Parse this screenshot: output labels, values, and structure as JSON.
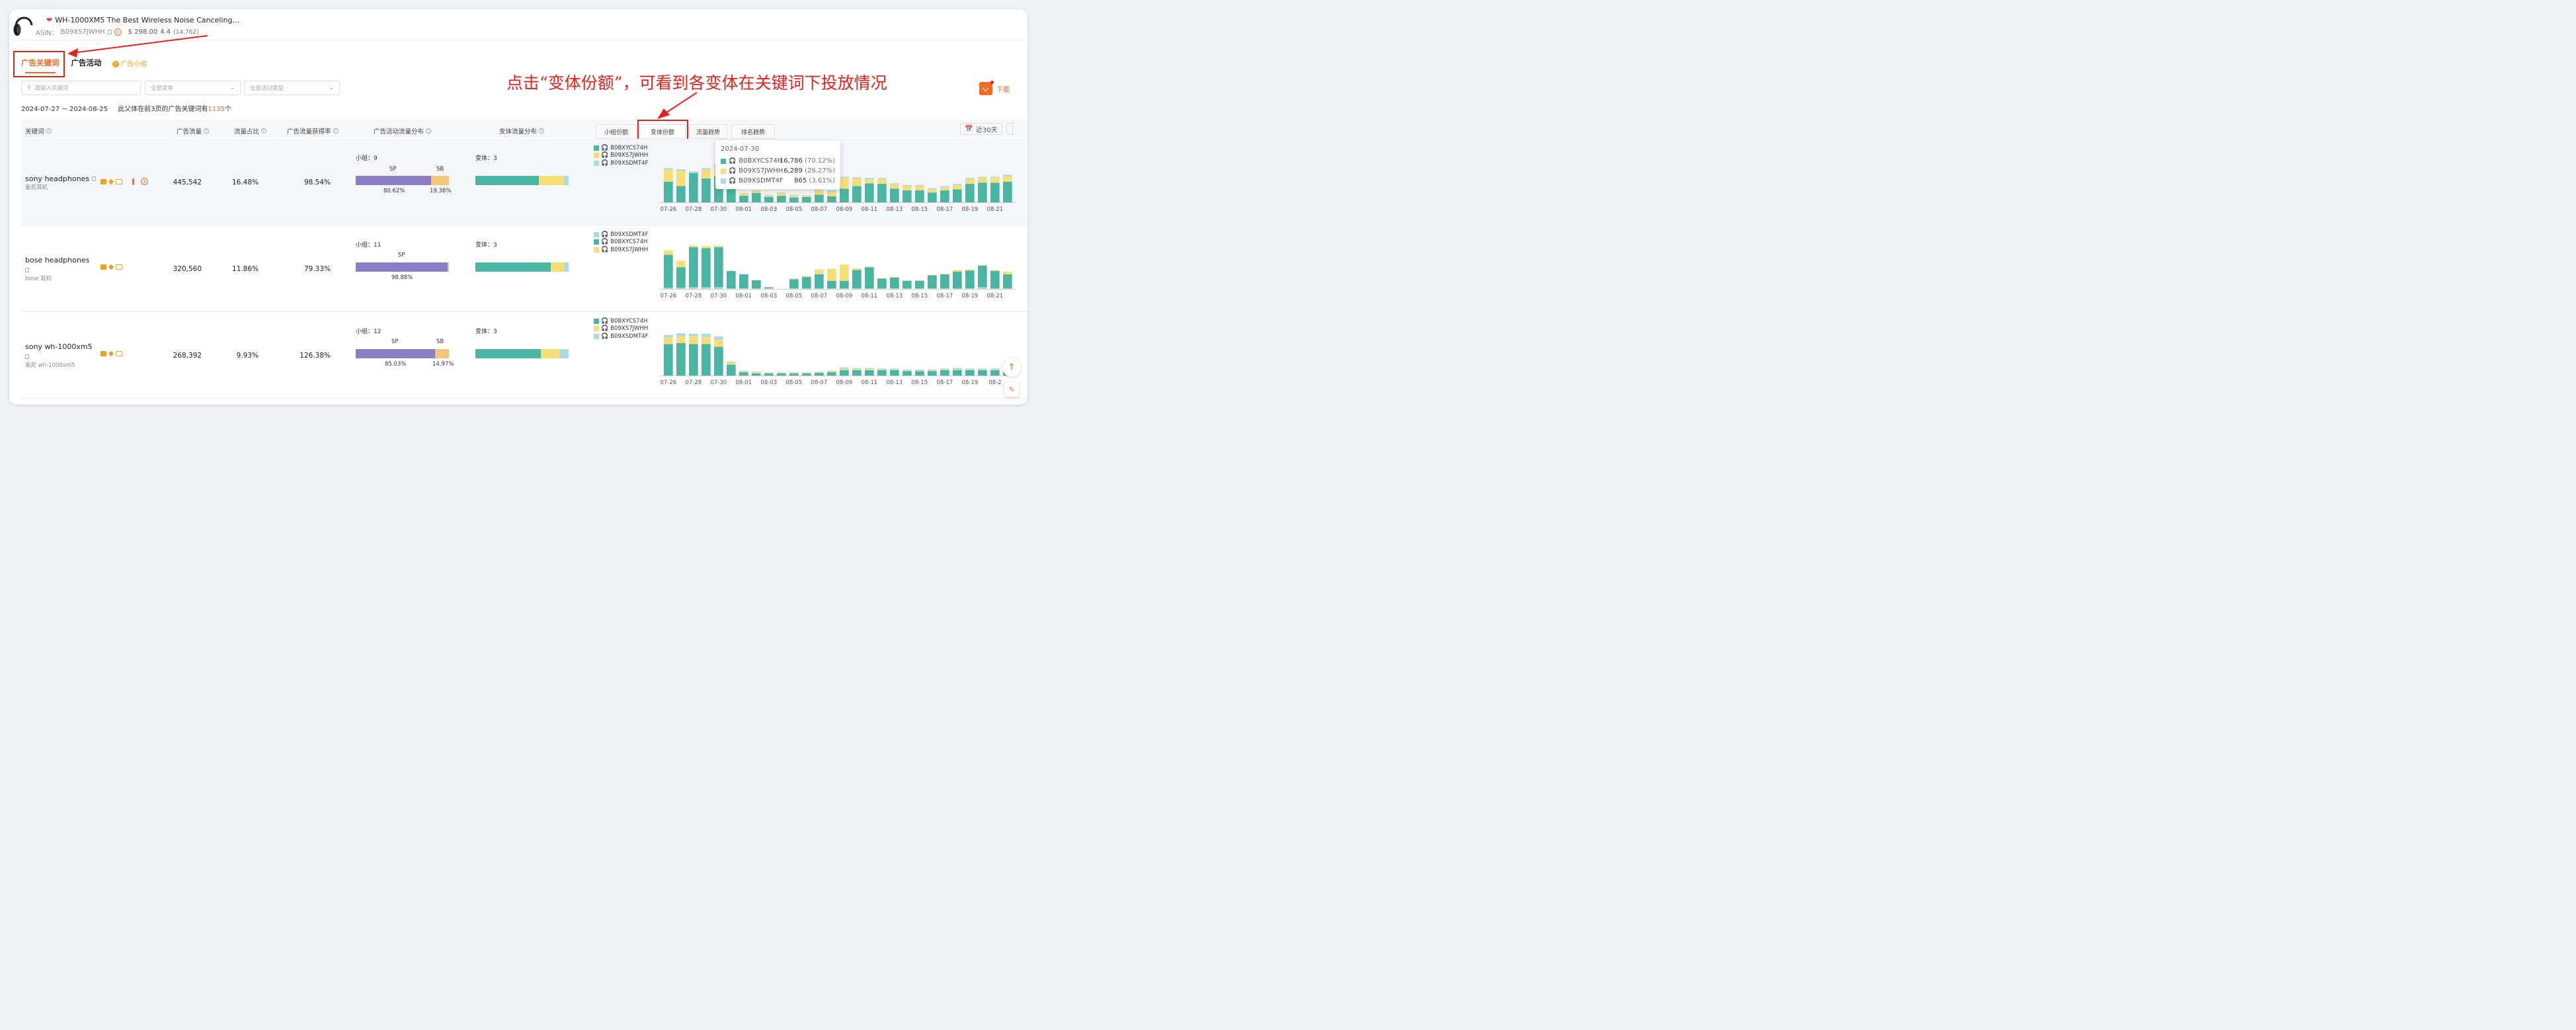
{
  "product": {
    "title": "WH-1000XM5 The Best Wireless Noise Canceling...",
    "asin_label": "ASIN：",
    "asin": "B09XS7JWHH",
    "price": "$ 298.00",
    "rating": "4.4",
    "reviews": "(14,762)",
    "badge": "3"
  },
  "tabs": {
    "keywords": "广告关键词",
    "campaigns": "广告活动",
    "groups": "广告小组"
  },
  "filters": {
    "search_placeholder": "请输入关键词",
    "variant_select": "全部变体",
    "campaign_type_select": "全部活动类型"
  },
  "summary": {
    "date_range": "2024-07-27 ~ 2024-08-25",
    "text_before": "此父体在前3页的广告关键词有",
    "count": "1135",
    "text_after": "个"
  },
  "annotation": "点击“变体份额”，可看到各变体在关键词下投放情况",
  "download_label": "下载",
  "columns": {
    "keyword": "关键词",
    "ad_traffic": "广告流量",
    "traffic_share": "流量占比",
    "capture_rate": "广告流量获得率",
    "campaign_dist": "广告活动流量分布",
    "variant_dist": "变体流量分布"
  },
  "subtabs": [
    "小组份额",
    "变体份额",
    "流量趋势",
    "排名趋势"
  ],
  "range_label": "近30天",
  "group_label": "小组：",
  "variant_label": "变体：",
  "colors": {
    "B0BXYCS74H": "#4ab5a2",
    "B09XS7JWHH": "#f7df76",
    "B09XSDMT4F": "#a9dbe8",
    "sp": "#8b7dc4",
    "sb": "#f5c67a",
    "accent": "#f26b21"
  },
  "x_ticks": [
    "07-26",
    "07-28",
    "07-30",
    "08-01",
    "08-03",
    "08-05",
    "08-07",
    "08-09",
    "08-11",
    "08-13",
    "08-15",
    "08-17",
    "08-19",
    "08-21"
  ],
  "x_ticks_row3": [
    "07-26",
    "07-28",
    "07-30",
    "08-01",
    "08-03",
    "08-05",
    "08-07",
    "08-09",
    "08-11",
    "08-13",
    "08-15",
    "08-17",
    "08-19",
    "08-2"
  ],
  "rows": [
    {
      "keyword": "sony headphones",
      "sub": "索尼耳机",
      "traffic": "445,542",
      "share": "16.48%",
      "rate": "98.54%",
      "groups": "9",
      "sp_label": "SP",
      "sb_label": "SB",
      "sp_pct": "80.62%",
      "sb_pct": "19.38%",
      "sp_value": 80.62,
      "variants": "3",
      "variant_split": [
        68,
        27,
        5
      ],
      "legend": [
        "B0BXYCS74H",
        "B09XS7JWHH",
        "B09XSDMT4F"
      ]
    },
    {
      "keyword": "bose headphones",
      "sub": "bose 耳机",
      "traffic": "320,560",
      "share": "11.86%",
      "rate": "79.33%",
      "groups": "11",
      "sp_label": "SP",
      "sp_pct": "98.88%",
      "sp_value": 98.88,
      "variants": "3",
      "variant_split": [
        81,
        14,
        5
      ],
      "legend": [
        "B09XSDMT4F",
        "B0BXYCS74H",
        "B09XS7JWHH"
      ]
    },
    {
      "keyword": "sony wh-1000xm5",
      "sub": "索尼 wh-1000xm5",
      "traffic": "268,392",
      "share": "9.93%",
      "rate": "126.38%",
      "groups": "12",
      "sp_label": "SP",
      "sb_label": "SB",
      "sp_pct": "85.03%",
      "sb_pct": "14.97%",
      "sp_value": 85.03,
      "variants": "3",
      "variant_split": [
        70,
        20,
        10
      ],
      "legend": [
        "B0BXYCS74H",
        "B09XS7JWHH",
        "B09XSDMT4F"
      ]
    }
  ],
  "tooltip": {
    "date": "2024-07-30",
    "items": [
      {
        "name": "B0BXYCS74H",
        "value": "16,786",
        "pct": "(70.12%)"
      },
      {
        "name": "B09XS7JWHH",
        "value": "6,289",
        "pct": "(26.27%)"
      },
      {
        "name": "B09XSDMT4F",
        "value": "865",
        "pct": "(3.61%)"
      }
    ]
  },
  "chart_data": [
    {
      "type": "bar",
      "stacked": true,
      "x": [
        "07-26",
        "07-27",
        "07-28",
        "07-29",
        "07-30",
        "07-31",
        "08-01",
        "08-02",
        "08-03",
        "08-04",
        "08-05",
        "08-06",
        "08-07",
        "08-08",
        "08-09",
        "08-10",
        "08-11",
        "08-12",
        "08-13",
        "08-14",
        "08-15",
        "08-16",
        "08-17",
        "08-18",
        "08-19",
        "08-20",
        "08-21",
        "08-22"
      ],
      "series": [
        {
          "name": "B0BXYCS74H",
          "values": [
            38,
            30,
            54,
            44,
            48,
            28,
            12,
            17,
            10,
            12,
            9,
            10,
            14,
            11,
            25,
            30,
            35,
            34,
            25,
            22,
            22,
            18,
            22,
            24,
            34,
            36,
            36,
            38
          ]
        },
        {
          "name": "B09XS7JWHH",
          "values": [
            22,
            28,
            0,
            16,
            18,
            4,
            4,
            4,
            3,
            4,
            3,
            2,
            8,
            8,
            20,
            14,
            7,
            9,
            8,
            8,
            8,
            6,
            6,
            8,
            9,
            9,
            9,
            10
          ]
        },
        {
          "name": "B09XSDMT4F",
          "values": [
            3,
            3,
            3,
            3,
            5,
            2,
            1,
            1,
            1,
            2,
            2,
            1,
            1,
            3,
            2,
            2,
            3,
            2,
            2,
            2,
            2,
            2,
            2,
            2,
            2,
            2,
            2,
            3
          ]
        }
      ]
    },
    {
      "type": "bar",
      "stacked": true,
      "x": [
        "07-26",
        "07-27",
        "07-28",
        "07-29",
        "07-30",
        "07-31",
        "08-01",
        "08-02",
        "08-03",
        "08-04",
        "08-05",
        "08-06",
        "08-07",
        "08-08",
        "08-09",
        "08-10",
        "08-11",
        "08-12",
        "08-13",
        "08-14",
        "08-15",
        "08-16",
        "08-17",
        "08-18",
        "08-19",
        "08-20",
        "08-21",
        "08-22"
      ],
      "series": [
        {
          "name": "B09XSDMT4F",
          "values": [
            2,
            2,
            3,
            3,
            3,
            1,
            1,
            1,
            1,
            0,
            1,
            1,
            1,
            1,
            1,
            1,
            1,
            1,
            1,
            1,
            1,
            1,
            1,
            1,
            1,
            3,
            1,
            1
          ]
        },
        {
          "name": "B0BXYCS74H",
          "values": [
            61,
            38,
            74,
            72,
            74,
            32,
            26,
            15,
            2,
            0,
            17,
            21,
            26,
            14,
            14,
            34,
            39,
            18,
            20,
            14,
            14,
            24,
            26,
            31,
            33,
            40,
            32,
            26
          ]
        },
        {
          "name": "B09XS7JWHH",
          "values": [
            8,
            12,
            3,
            4,
            3,
            0,
            0,
            0,
            0,
            0,
            1,
            2,
            9,
            22,
            30,
            3,
            1,
            1,
            1,
            1,
            1,
            1,
            1,
            3,
            2,
            1,
            2,
            5
          ]
        }
      ]
    },
    {
      "type": "bar",
      "stacked": true,
      "x": [
        "07-26",
        "07-27",
        "07-28",
        "07-29",
        "07-30",
        "07-31",
        "08-01",
        "08-02",
        "08-03",
        "08-04",
        "08-05",
        "08-06",
        "08-07",
        "08-08",
        "08-09",
        "08-10",
        "08-11",
        "08-12",
        "08-13",
        "08-14",
        "08-15",
        "08-16",
        "08-17",
        "08-18",
        "08-19",
        "08-20",
        "08-21",
        "08-22"
      ],
      "series": [
        {
          "name": "B0BXYCS74H",
          "values": [
            58,
            60,
            58,
            58,
            53,
            20,
            6,
            4,
            4,
            4,
            4,
            4,
            5,
            6,
            10,
            10,
            10,
            10,
            10,
            8,
            8,
            8,
            10,
            10,
            10,
            10,
            10,
            10
          ]
        },
        {
          "name": "B09XS7JWHH",
          "values": [
            12,
            12,
            14,
            13,
            13,
            4,
            2,
            2,
            1,
            1,
            1,
            1,
            1,
            2,
            2,
            2,
            2,
            1,
            1,
            1,
            1,
            1,
            1,
            1,
            1,
            1,
            1,
            1
          ]
        },
        {
          "name": "B09XSDMT4F",
          "values": [
            5,
            6,
            5,
            6,
            6,
            2,
            1,
            1,
            1,
            1,
            1,
            1,
            1,
            1,
            3,
            2,
            2,
            2,
            2,
            2,
            2,
            2,
            2,
            3,
            2,
            2,
            2,
            2
          ]
        }
      ]
    }
  ]
}
